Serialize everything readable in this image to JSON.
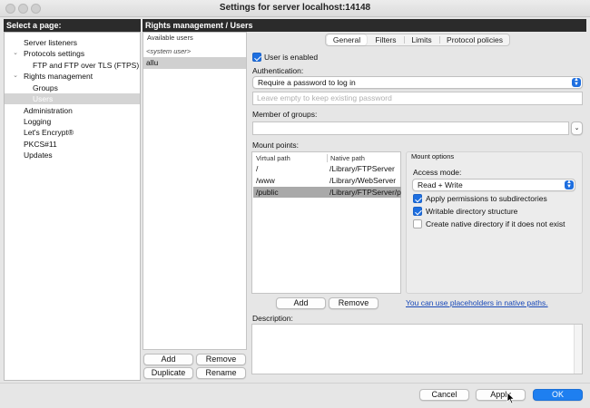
{
  "window": {
    "title": "Settings for server localhost:14148"
  },
  "left": {
    "header": "Select a page:",
    "items": [
      {
        "label": "Server listeners",
        "indent": 0,
        "chevron": ""
      },
      {
        "label": "Protocols settings",
        "indent": 0,
        "chevron": "v"
      },
      {
        "label": "FTP and FTP over TLS (FTPS)",
        "indent": 1,
        "chevron": ""
      },
      {
        "label": "Rights management",
        "indent": 0,
        "chevron": "v"
      },
      {
        "label": "Groups",
        "indent": 1,
        "chevron": ""
      },
      {
        "label": "Users",
        "indent": 1,
        "chevron": "",
        "selected": true
      },
      {
        "label": "Administration",
        "indent": 0,
        "chevron": ""
      },
      {
        "label": "Logging",
        "indent": 0,
        "chevron": ""
      },
      {
        "label": "Let's Encrypt®",
        "indent": 0,
        "chevron": ""
      },
      {
        "label": "PKCS#11",
        "indent": 0,
        "chevron": ""
      },
      {
        "label": "Updates",
        "indent": 0,
        "chevron": ""
      }
    ]
  },
  "right": {
    "header": "Rights management / Users"
  },
  "users": {
    "column_header": "Available users",
    "system_user": "<system user>",
    "selected_user": "allu",
    "add_label": "Add",
    "remove_label": "Remove",
    "duplicate_label": "Duplicate",
    "rename_label": "Rename"
  },
  "tabs": {
    "general": "General",
    "filters": "Filters",
    "limits": "Limits",
    "protocol_policies": "Protocol policies"
  },
  "general": {
    "user_enabled_label": "User is enabled",
    "user_enabled": true,
    "authentication_label": "Authentication:",
    "authentication_value": "Require a password to log in",
    "password_placeholder": "Leave empty to keep existing password",
    "member_of_groups_label": "Member of groups:",
    "member_of_groups_value": "",
    "mount_points_label": "Mount points:",
    "mount_table": {
      "virtual_header": "Virtual path",
      "native_header": "Native path",
      "rows": [
        {
          "virtual": "/",
          "native": "/Library/FTPServer"
        },
        {
          "virtual": "/www",
          "native": "/Library/WebServer"
        },
        {
          "virtual": "/public",
          "native": "/Library/FTPServer/p",
          "selected": true
        }
      ]
    },
    "mount_options": {
      "title": "Mount options",
      "access_mode_label": "Access mode:",
      "access_mode_value": "Read + Write",
      "apply_permissions_label": "Apply permissions to subdirectories",
      "apply_permissions": true,
      "writable_structure_label": "Writable directory structure",
      "writable_structure": true,
      "create_native_label": "Create native directory if it does not exist",
      "create_native": false
    },
    "mount_add_label": "Add",
    "mount_remove_label": "Remove",
    "placeholders_link": "You can use placeholders in native paths.",
    "description_label": "Description:",
    "description_value": ""
  },
  "footer": {
    "cancel_label": "Cancel",
    "apply_label": "Apply",
    "ok_label": "OK"
  },
  "colors": {
    "accent": "#1e7ff0",
    "header_bar": "#2b2b2b",
    "link": "#1848b8"
  }
}
